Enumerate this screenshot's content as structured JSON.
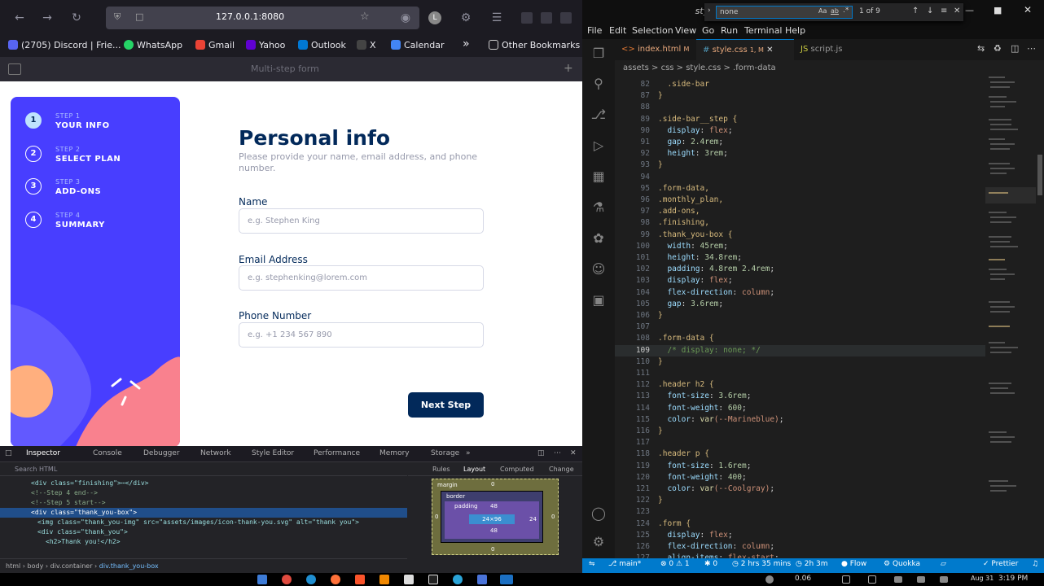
{
  "firefox": {
    "url": "127.0.0.1:8080",
    "bookmarks": [
      {
        "label": "(2705) Discord | Frie...",
        "color": "#5865f2"
      },
      {
        "label": "WhatsApp",
        "color": "#25d366"
      },
      {
        "label": "Gmail",
        "color": "#ea4335"
      },
      {
        "label": "Yahoo",
        "color": "#6001d2"
      },
      {
        "label": "Outlook",
        "color": "#0078d4"
      },
      {
        "label": "X",
        "color": "#000000"
      },
      {
        "label": "Calendar",
        "color": "#4285f4"
      }
    ],
    "other_bookmarks": "Other Bookmarks",
    "tab_ghost": "Multi-step form"
  },
  "page": {
    "steps": [
      {
        "num": "1",
        "sub": "STEP 1",
        "title": "YOUR INFO",
        "active": true
      },
      {
        "num": "2",
        "sub": "STEP 2",
        "title": "SELECT PLAN",
        "active": false
      },
      {
        "num": "3",
        "sub": "STEP 3",
        "title": "ADD-ONS",
        "active": false
      },
      {
        "num": "4",
        "sub": "STEP 4",
        "title": "SUMMARY",
        "active": false
      }
    ],
    "title": "Personal info",
    "description": "Please provide your name, email address, and phone number.",
    "fields": [
      {
        "label": "Name",
        "placeholder": "e.g. Stephen King"
      },
      {
        "label": "Email Address",
        "placeholder": "e.g. stephenking@lorem.com"
      },
      {
        "label": "Phone Number",
        "placeholder": "e.g. +1 234 567 890"
      }
    ],
    "next_button": "Next Step",
    "colors": {
      "sidebar": "#483eff",
      "primary": "#02295a"
    }
  },
  "devtools": {
    "tabs": [
      "Inspector",
      "Console",
      "Debugger",
      "Network",
      "Style Editor",
      "Performance",
      "Memory",
      "Storage"
    ],
    "search_placeholder": "Search HTML",
    "html_lines": [
      "<div class=\"finishing\">⋯</div>",
      "<!--Step 4 end-->",
      "<!--Step 5 start-->",
      "<div class=\"thank_you-box\">",
      "<img class=\"thank_you-img\" src=\"assets/images/icon-thank-you.svg\" alt=\"thank you\">",
      "<div class=\"thank_you\">",
      "<h2>Thank you!</h2>"
    ],
    "breadcrumbs": [
      "html",
      "body",
      "div.container",
      "div.thank_you-box"
    ],
    "side_tabs": [
      "Rules",
      "Layout",
      "Computed",
      "Change"
    ],
    "boxmodel": {
      "margin": "margin",
      "border": "border",
      "padding": "padding",
      "padding_val": "48",
      "content": "24×96",
      "side": "24",
      "zero": "0"
    }
  },
  "vscode": {
    "title": "style.css - multi-step-form-main - Visual Studio Code",
    "menu": [
      "File",
      "Edit",
      "Selection",
      "View",
      "Go",
      "Run",
      "Terminal",
      "Help"
    ],
    "tabs": [
      {
        "label": "index.html",
        "badge": "M",
        "color": "#e37933"
      },
      {
        "label": "style.css",
        "badge": "1, M",
        "color": "#519aba"
      },
      {
        "label": "script.js",
        "badge": "",
        "color": "#cbcb41"
      }
    ],
    "breadcrumb": "assets > css > style.css > .form-data",
    "find": {
      "query": "none",
      "result": "1 of 9"
    },
    "lines": [
      {
        "n": "82",
        "t": "  .side-bar"
      },
      {
        "n": "87",
        "t": "}"
      },
      {
        "n": "88",
        "t": ""
      },
      {
        "n": "89",
        "t": ".side-bar__step {"
      },
      {
        "n": "90",
        "t": "  display: flex;"
      },
      {
        "n": "91",
        "t": "  gap: 2.4rem;"
      },
      {
        "n": "92",
        "t": "  height: 3rem;"
      },
      {
        "n": "93",
        "t": "}"
      },
      {
        "n": "94",
        "t": ""
      },
      {
        "n": "95",
        "t": ".form-data,"
      },
      {
        "n": "96",
        "t": ".monthly_plan,"
      },
      {
        "n": "97",
        "t": ".add-ons,"
      },
      {
        "n": "98",
        "t": ".finishing,"
      },
      {
        "n": "99",
        "t": ".thank_you-box {"
      },
      {
        "n": "100",
        "t": "  width: 45rem;"
      },
      {
        "n": "101",
        "t": "  height: 34.8rem;"
      },
      {
        "n": "102",
        "t": "  padding: 4.8rem 2.4rem;"
      },
      {
        "n": "103",
        "t": "  display: flex;"
      },
      {
        "n": "104",
        "t": "  flex-direction: column;"
      },
      {
        "n": "105",
        "t": "  gap: 3.6rem;"
      },
      {
        "n": "106",
        "t": "}"
      },
      {
        "n": "107",
        "t": ""
      },
      {
        "n": "108",
        "t": ".form-data {"
      },
      {
        "n": "109",
        "t": "  /* display: none; */"
      },
      {
        "n": "110",
        "t": "}"
      },
      {
        "n": "111",
        "t": ""
      },
      {
        "n": "112",
        "t": ".header h2 {"
      },
      {
        "n": "113",
        "t": "  font-size: 3.6rem;"
      },
      {
        "n": "114",
        "t": "  font-weight: 600;"
      },
      {
        "n": "115",
        "t": "  color: var(--Marineblue);"
      },
      {
        "n": "116",
        "t": "}"
      },
      {
        "n": "117",
        "t": ""
      },
      {
        "n": "118",
        "t": ".header p {"
      },
      {
        "n": "119",
        "t": "  font-size: 1.6rem;"
      },
      {
        "n": "120",
        "t": "  font-weight: 400;"
      },
      {
        "n": "121",
        "t": "  color: var(--Coolgray);"
      },
      {
        "n": "122",
        "t": "}"
      },
      {
        "n": "123",
        "t": ""
      },
      {
        "n": "124",
        "t": ".form {"
      },
      {
        "n": "125",
        "t": "  display: flex;"
      },
      {
        "n": "126",
        "t": "  flex-direction: column;"
      },
      {
        "n": "127",
        "t": "  align-items: flex-start;"
      }
    ],
    "status": {
      "branch": "main*",
      "problems": "⊗ 0 ⚠ 1",
      "ports": "✱ 0",
      "time1": "2 hrs 35 mins",
      "time2": "2h 3m",
      "flow": "Flow",
      "quokka": "Quokka",
      "prettier": "✓ Prettier"
    }
  },
  "taskbar": {
    "time": "3:19 PM",
    "date": "Aug 31",
    "vol": "0.06"
  }
}
